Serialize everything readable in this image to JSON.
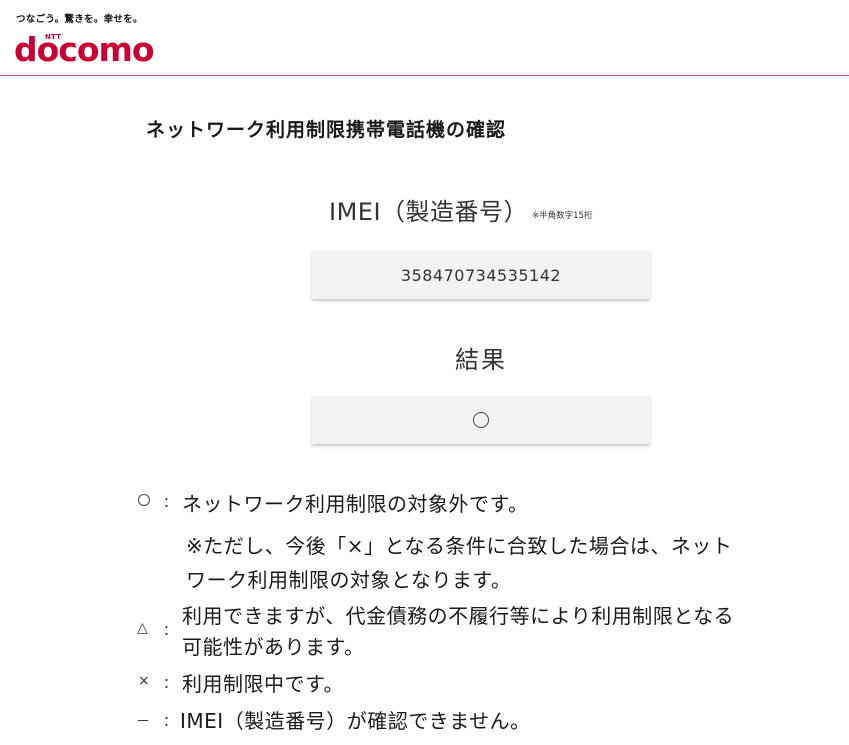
{
  "header": {
    "tagline": "つなごう。驚きを。幸せを。",
    "logo_ntt": "NTT",
    "logo_word": "docomo",
    "brand_color": "#cc0033"
  },
  "page_title": "ネットワーク利用制限携帯電話機の確認",
  "imei": {
    "heading": "IMEI（製造番号）",
    "note": "※半角数字15桁",
    "value": "358470734535142"
  },
  "result": {
    "heading": "結果",
    "value_icon": "circle-mark"
  },
  "legend": {
    "circle": {
      "sep": "：",
      "text": "ネットワーク利用制限の対象外です。",
      "note_line1": "※ただし、今後「×」となる条件に合致した場合は、ネット",
      "note_line2": "ワーク利用制限の対象となります。"
    },
    "triangle": {
      "symbol": "△",
      "sep": "：",
      "line1": "利用できますが、代金債務の不履行等により利用制限となる",
      "line2": "可能性があります。"
    },
    "cross": {
      "symbol": "×",
      "sep": "：",
      "text": "利用制限中です。"
    },
    "dash": {
      "symbol": "－",
      "sep": "：",
      "text": "IMEI（製造番号）が確認できません。"
    }
  }
}
